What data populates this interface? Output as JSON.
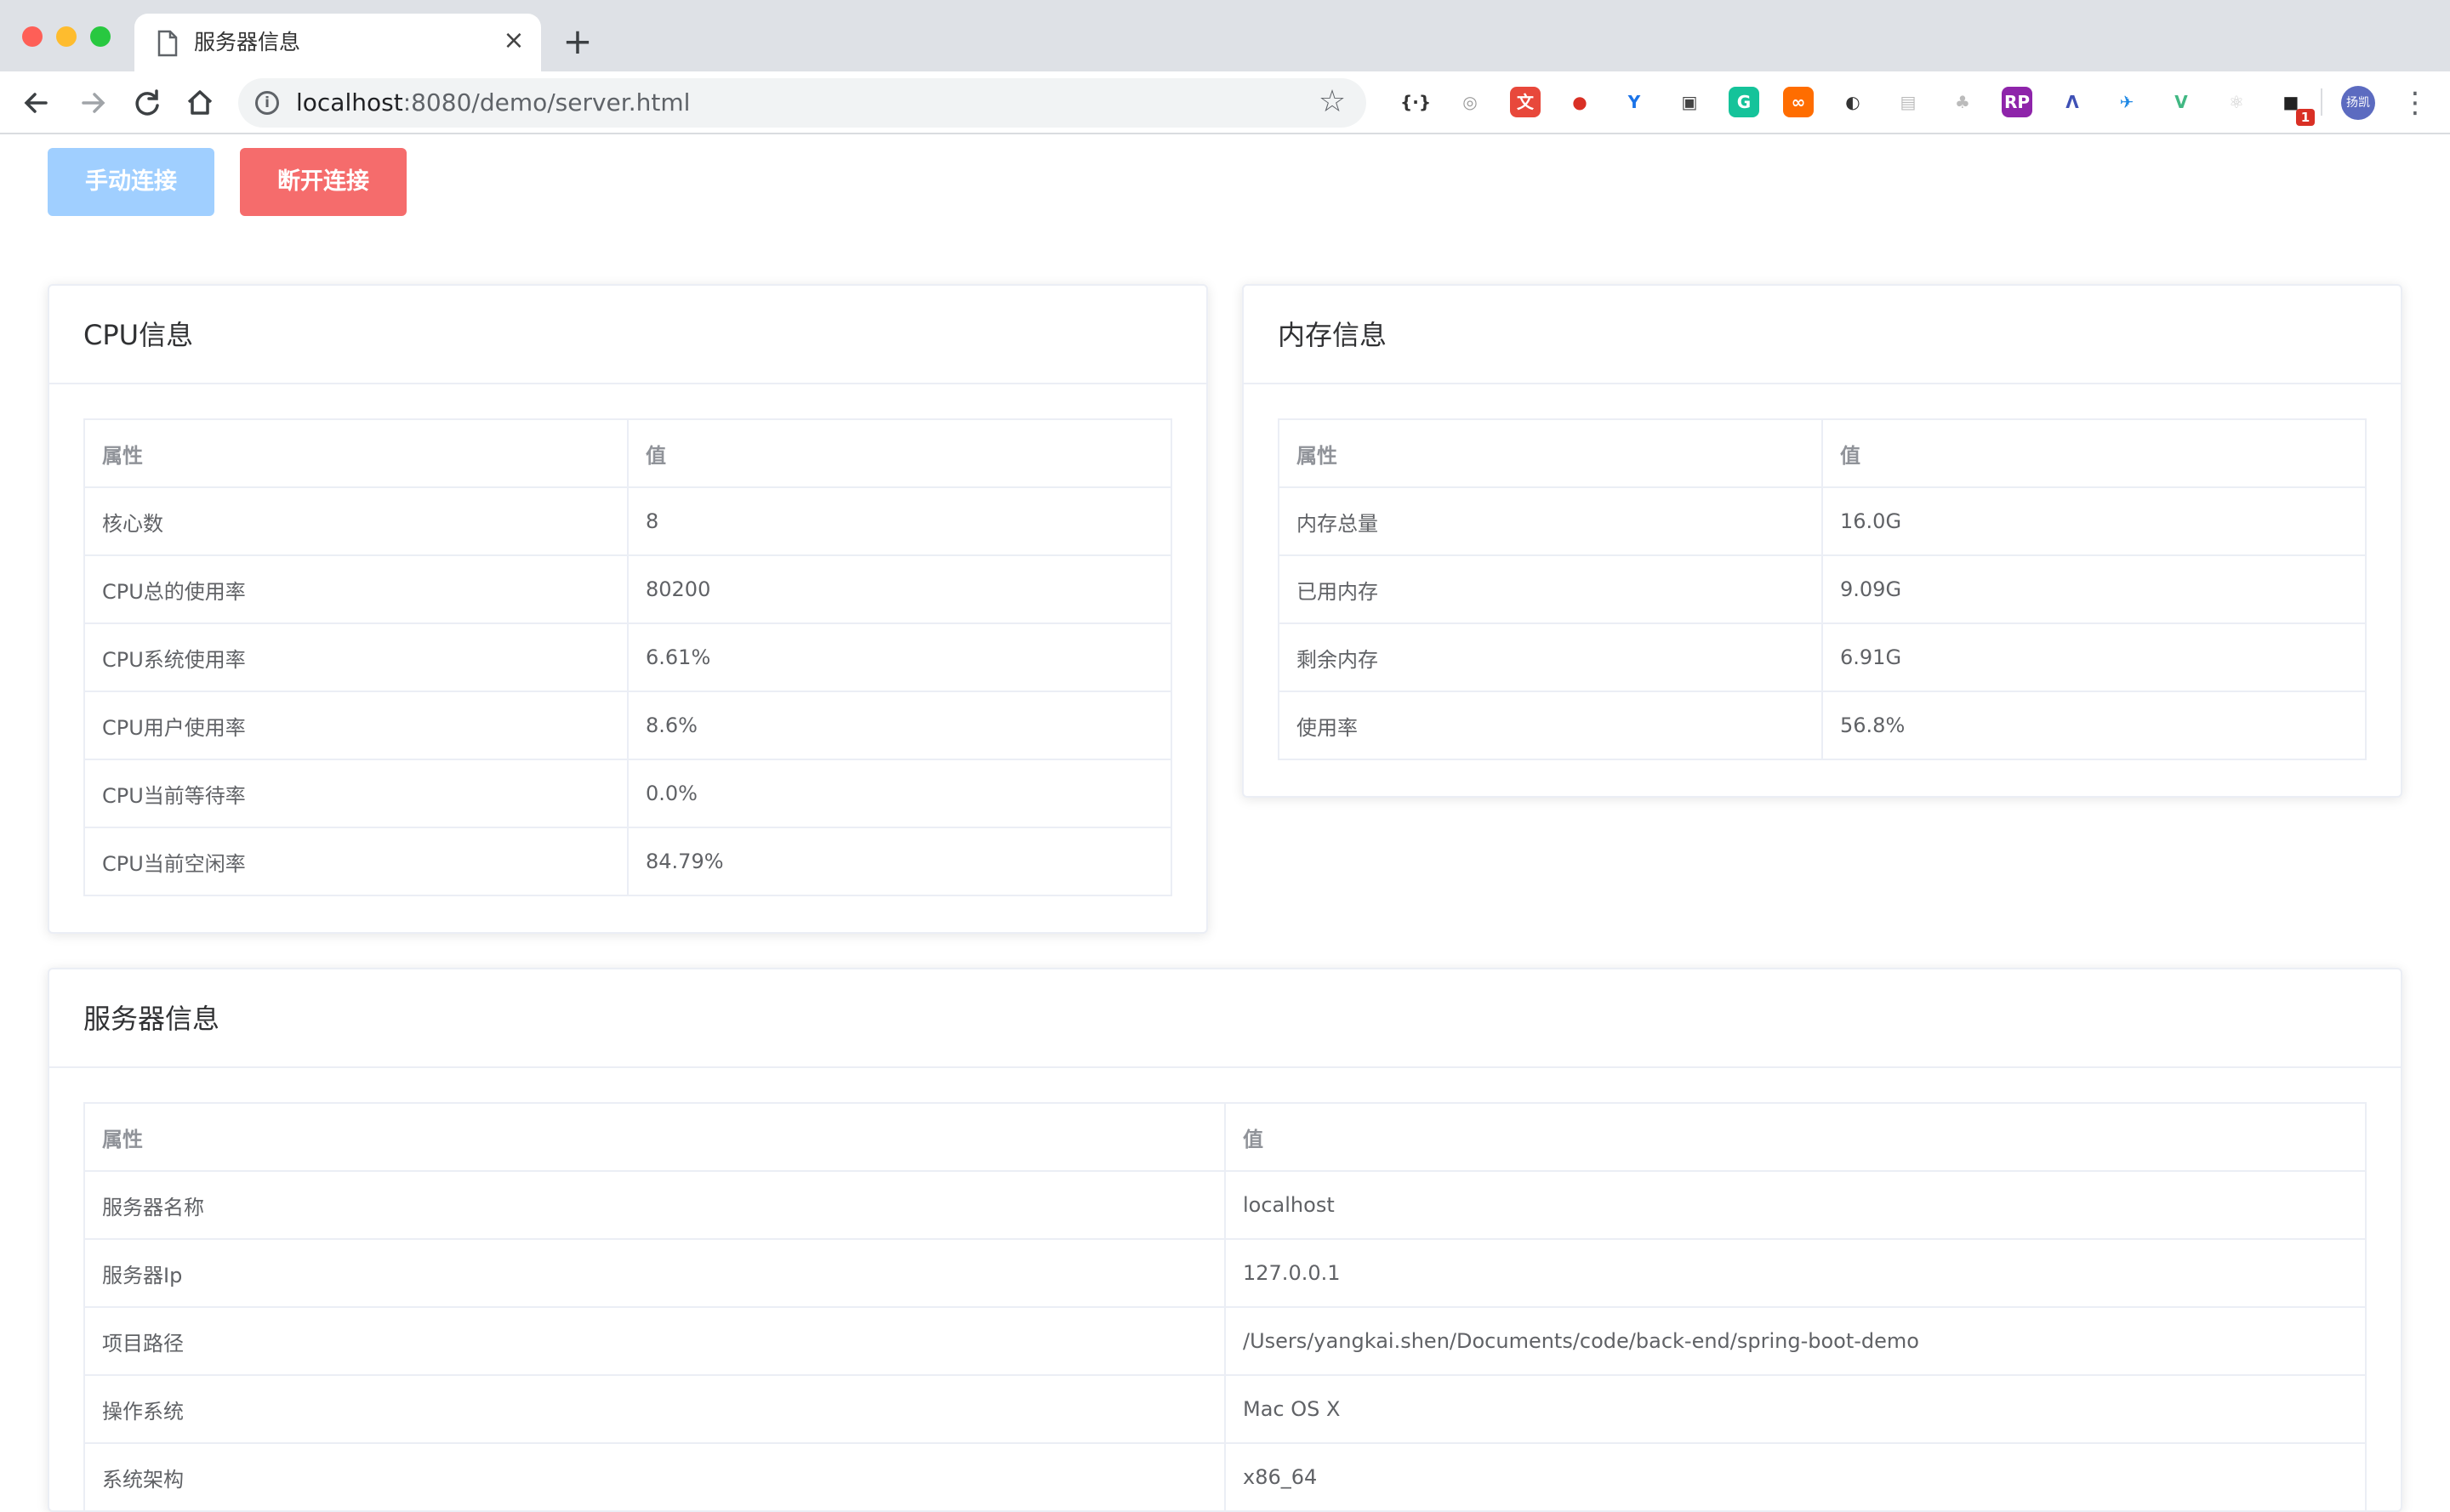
{
  "browser": {
    "tab_title": "服务器信息",
    "tab_close": "×",
    "new_tab": "+",
    "url_host": "localhost",
    "url_rest": ":8080/demo/server.html",
    "extensions": [
      {
        "name": "json-viewer-icon",
        "glyph": "{·}",
        "color": "#ffffff",
        "fg": "#333333"
      },
      {
        "name": "camera-lens-icon",
        "glyph": "◎",
        "color": "#ffffff",
        "fg": "#999999"
      },
      {
        "name": "translate-icon",
        "glyph": "文",
        "color": "#e8483b",
        "fg": "#ffffff"
      },
      {
        "name": "santa-icon",
        "glyph": "●",
        "color": "#ffffff",
        "fg": "#d93025"
      },
      {
        "name": "y-extension-icon",
        "glyph": "Y",
        "color": "#ffffff",
        "fg": "#1a73e8"
      },
      {
        "name": "camera-icon",
        "glyph": "▣",
        "color": "#ffffff",
        "fg": "#444444"
      },
      {
        "name": "grammarly-icon",
        "glyph": "G",
        "color": "#15c39a",
        "fg": "#ffffff"
      },
      {
        "name": "infinity-icon",
        "glyph": "∞",
        "color": "#ff6d00",
        "fg": "#ffffff"
      },
      {
        "name": "dark-circle-icon",
        "glyph": "◐",
        "color": "#ffffff",
        "fg": "#333333"
      },
      {
        "name": "qr-icon",
        "glyph": "▤",
        "color": "#ffffff",
        "fg": "#bbbbbb"
      },
      {
        "name": "tree-icon",
        "glyph": "♣",
        "color": "#ffffff",
        "fg": "#bbbbbb"
      },
      {
        "name": "rp-icon",
        "glyph": "RP",
        "color": "#8e24aa",
        "fg": "#ffffff"
      },
      {
        "name": "lambda-icon",
        "glyph": "Λ",
        "color": "#ffffff",
        "fg": "#3f51b5"
      },
      {
        "name": "bird-icon",
        "glyph": "✈",
        "color": "#ffffff",
        "fg": "#1e88e5"
      },
      {
        "name": "vue-devtools-icon",
        "glyph": "V",
        "color": "#ffffff",
        "fg": "#41b883"
      },
      {
        "name": "react-icon",
        "glyph": "⚛",
        "color": "#ffffff",
        "fg": "#cccccc"
      },
      {
        "name": "notification-extension-icon",
        "glyph": "■",
        "color": "#ffffff",
        "fg": "#222222",
        "badge": "1"
      }
    ],
    "profile_label": "扬凯"
  },
  "actions": {
    "connect_label": "手动连接",
    "disconnect_label": "断开连接"
  },
  "cpu": {
    "title": "CPU信息",
    "header": [
      "属性",
      "值"
    ],
    "rows": [
      [
        "核心数",
        "8"
      ],
      [
        "CPU总的使用率",
        "80200"
      ],
      [
        "CPU系统使用率",
        "6.61%"
      ],
      [
        "CPU用户使用率",
        "8.6%"
      ],
      [
        "CPU当前等待率",
        "0.0%"
      ],
      [
        "CPU当前空闲率",
        "84.79%"
      ]
    ]
  },
  "memory": {
    "title": "内存信息",
    "header": [
      "属性",
      "值"
    ],
    "rows": [
      [
        "内存总量",
        "16.0G"
      ],
      [
        "已用内存",
        "9.09G"
      ],
      [
        "剩余内存",
        "6.91G"
      ],
      [
        "使用率",
        "56.8%"
      ]
    ]
  },
  "server": {
    "title": "服务器信息",
    "header": [
      "属性",
      "值"
    ],
    "rows": [
      [
        "服务器名称",
        "localhost"
      ],
      [
        "服务器Ip",
        "127.0.0.1"
      ],
      [
        "项目路径",
        "/Users/yangkai.shen/Documents/code/back-end/spring-boot-demo"
      ],
      [
        "操作系统",
        "Mac OS X"
      ],
      [
        "系统架构",
        "x86_64"
      ]
    ]
  }
}
